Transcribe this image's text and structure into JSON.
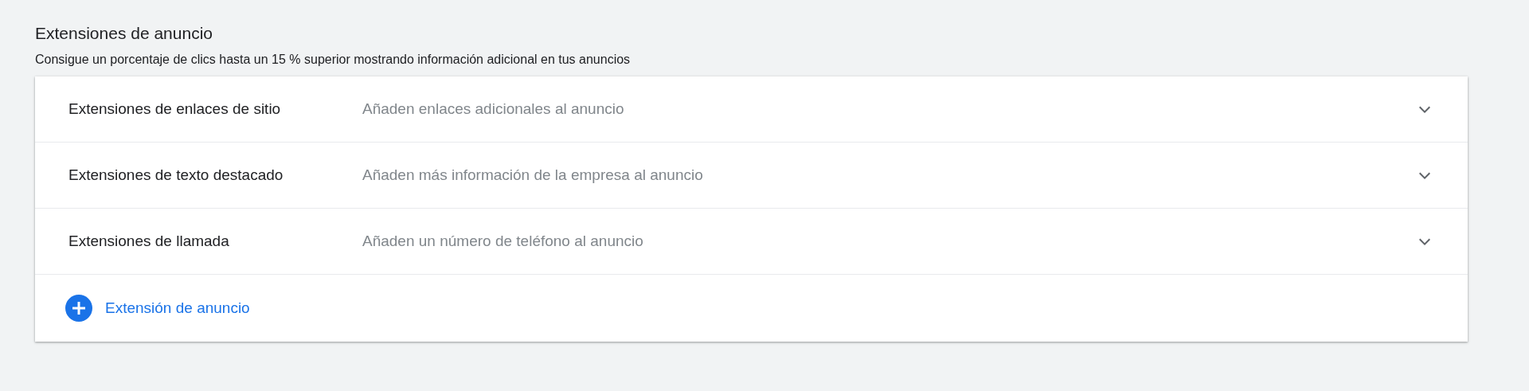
{
  "section": {
    "title": "Extensiones de anuncio",
    "subtitle": "Consigue un porcentaje de clics hasta un 15 % superior mostrando información adicional en tus anuncios"
  },
  "extensions": [
    {
      "title": "Extensiones de enlaces de sitio",
      "description": "Añaden enlaces adicionales al anuncio",
      "expanded": false
    },
    {
      "title": "Extensiones de texto destacado",
      "description": "Añaden más información de la empresa al anuncio",
      "expanded": false
    },
    {
      "title": "Extensiones de llamada",
      "description": "Añaden un número de teléfono al anuncio",
      "expanded": false
    }
  ],
  "add_button": {
    "label": "Extensión de anuncio"
  }
}
